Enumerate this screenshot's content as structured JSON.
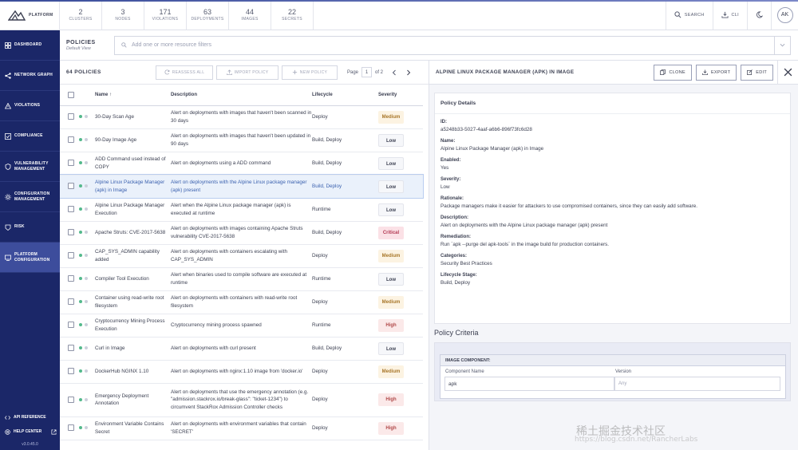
{
  "header": {
    "platform_label": "PLATFORM",
    "stats": [
      {
        "value": "2",
        "label": "CLUSTERS"
      },
      {
        "value": "3",
        "label": "NODES"
      },
      {
        "value": "171",
        "label": "VIOLATIONS"
      },
      {
        "value": "63",
        "label": "DEPLOYMENTS"
      },
      {
        "value": "44",
        "label": "IMAGES"
      },
      {
        "value": "22",
        "label": "SECRETS"
      }
    ],
    "search_label": "SEARCH",
    "cli_label": "CLI",
    "avatar_initials": "AK"
  },
  "sidebar": {
    "items": [
      {
        "label": "DASHBOARD",
        "icon": "dashboard-icon"
      },
      {
        "label": "NETWORK GRAPH",
        "icon": "network-icon"
      },
      {
        "label": "VIOLATIONS",
        "icon": "alert-icon"
      },
      {
        "label": "COMPLIANCE",
        "icon": "check-square-icon"
      },
      {
        "label": "VULNERABILITY MANAGEMENT",
        "icon": "shield-icon"
      },
      {
        "label": "CONFIGURATION MANAGEMENT",
        "icon": "settings-icon"
      },
      {
        "label": "RISK",
        "icon": "warning-icon"
      },
      {
        "label": "PLATFORM CONFIGURATION",
        "icon": "platform-icon"
      }
    ],
    "active_index": 7,
    "api_reference": "API REFERENCE",
    "help_center": "HELP CENTER",
    "version": "v3.0.45.0"
  },
  "policies_header": {
    "title": "POLICIES",
    "subtitle": "Default View",
    "filter_placeholder": "Add one or more resource filters"
  },
  "toolbar": {
    "count": "64 POLICIES",
    "reassess": "REASSESS ALL",
    "import": "IMPORT POLICY",
    "new": "NEW POLICY",
    "page_label": "Page",
    "page_value": "1",
    "page_of": "of 2"
  },
  "table": {
    "columns": {
      "name": "Name",
      "description": "Description",
      "lifecycle": "Lifecycle",
      "severity": "Severity"
    },
    "rows": [
      {
        "name": "30-Day Scan Age",
        "description": "Alert on deployments with images that haven't been scanned in 30 days",
        "lifecycle": "Deploy",
        "severity": "Medium"
      },
      {
        "name": "90-Day Image Age",
        "description": "Alert on deployments with images that haven't been updated in 90 days",
        "lifecycle": "Build, Deploy",
        "severity": "Low"
      },
      {
        "name": "ADD Command used instead of COPY",
        "description": "Alert on deployments using a ADD command",
        "lifecycle": "Build, Deploy",
        "severity": "Low"
      },
      {
        "name": "Alpine Linux Package Manager (apk) in Image",
        "description": "Alert on deployments with the Alpine Linux package manager (apk) present",
        "lifecycle": "Build, Deploy",
        "severity": "Low"
      },
      {
        "name": "Alpine Linux Package Manager Execution",
        "description": "Alert when the Alpine Linux package manager (apk) is executed at runtime",
        "lifecycle": "Runtime",
        "severity": "Low"
      },
      {
        "name": "Apache Struts: CVE-2017-5638",
        "description": "Alert on deployments with images containing Apache Struts vulnerability CVE-2017-5638",
        "lifecycle": "Build, Deploy",
        "severity": "Critical"
      },
      {
        "name": "CAP_SYS_ADMIN capability added",
        "description": "Alert on deployments with containers escalating with CAP_SYS_ADMIN",
        "lifecycle": "Deploy",
        "severity": "Medium"
      },
      {
        "name": "Compiler Tool Execution",
        "description": "Alert when binaries used to compile software are executed at runtime",
        "lifecycle": "Runtime",
        "severity": "Low"
      },
      {
        "name": "Container using read-write root filesystem",
        "description": "Alert on deployments with containers with read-write root filesystem",
        "lifecycle": "Deploy",
        "severity": "Medium"
      },
      {
        "name": "Cryptocurrency Mining Process Execution",
        "description": "Cryptocurrency mining process spawned",
        "lifecycle": "Runtime",
        "severity": "High"
      },
      {
        "name": "Curl in Image",
        "description": "Alert on deployments with curl present",
        "lifecycle": "Build, Deploy",
        "severity": "Low"
      },
      {
        "name": "DockerHub NGINX 1.10",
        "description": "Alert on deployments with nginx:1.10 image from 'docker.io'",
        "lifecycle": "Deploy",
        "severity": "Medium"
      },
      {
        "name": "Emergency Deployment Annotation",
        "description": "Alert on deployments that use the emergency annotation (e.g. \"admission.stackrox.io/break-glass\": \"ticket-1234\") to circumvent StackRox Admission Controller checks",
        "lifecycle": "Deploy",
        "severity": "High"
      },
      {
        "name": "Environment Variable Contains Secret",
        "description": "Alert on deployments with environment variables that contain 'SECRET'",
        "lifecycle": "Deploy",
        "severity": "High"
      }
    ],
    "selected_index": 3
  },
  "detail": {
    "title": "ALPINE LINUX PACKAGE MANAGER (APK) IN IMAGE",
    "clone": "CLONE",
    "export": "EXPORT",
    "edit": "EDIT",
    "card_title": "Policy Details",
    "fields": [
      {
        "key": "ID:",
        "value": "a5248b33-5027-4aaf-a6b6-896f73fc6d28"
      },
      {
        "key": "Name:",
        "value": "Alpine Linux Package Manager (apk) in Image"
      },
      {
        "key": "Enabled:",
        "value": "Yes"
      },
      {
        "key": "Severity:",
        "value": "Low"
      },
      {
        "key": "Rationale:",
        "value": "Package managers make it easier for attackers to use compromised containers, since they can easily add software."
      },
      {
        "key": "Description:",
        "value": "Alert on deployments with the Alpine Linux package manager (apk) present"
      },
      {
        "key": "Remediation:",
        "value": "Run `apk --purge del apk-tools` in the image build for production containers."
      },
      {
        "key": "Categories:",
        "value": "Security Best Practices"
      },
      {
        "key": "Lifecycle Stage:",
        "value": "Build, Deploy"
      }
    ],
    "criteria_title": "Policy Criteria",
    "criteria_section": "IMAGE COMPONENT:",
    "component_name_label": "Component Name",
    "version_label": "Version",
    "component_name_value": "apk",
    "version_placeholder": "Any"
  },
  "watermark": {
    "text": "稀土掘金技术社区",
    "url": "https://blog.csdn.net/RancherLabs"
  },
  "colors": {
    "nav_bg": "#1b2768",
    "nav_active": "#3d4d9c",
    "selected_row": "#eaf1fb",
    "status_green": "#54b98c"
  }
}
